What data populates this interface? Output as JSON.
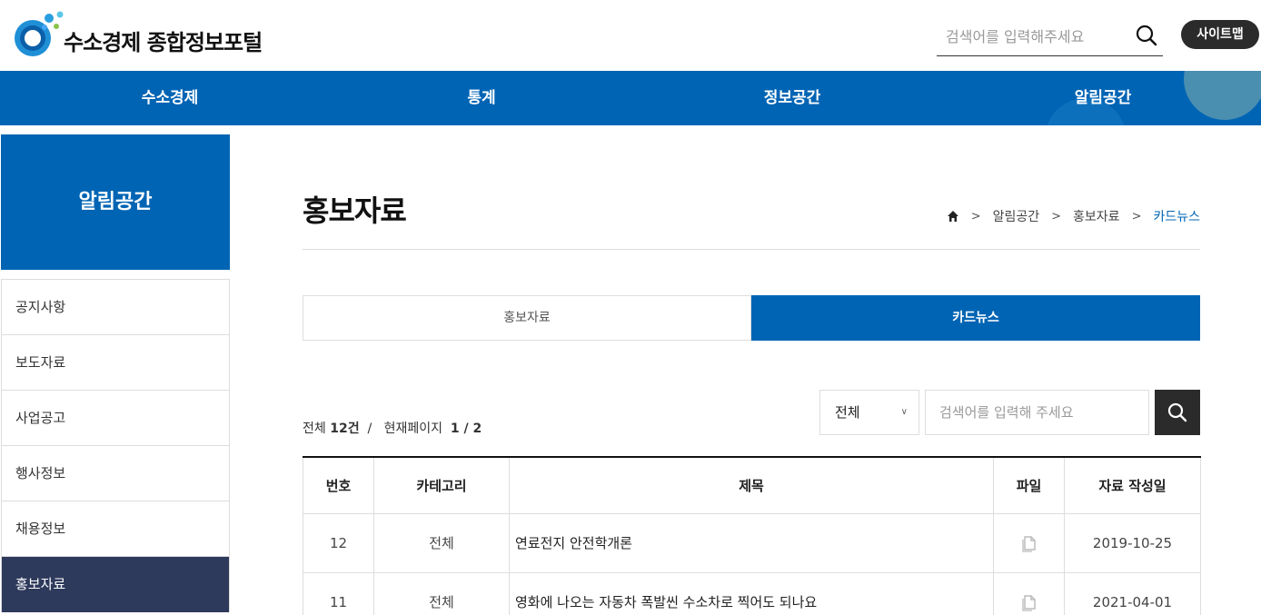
{
  "header": {
    "site_title": "수소경제 종합정보포털",
    "search_placeholder": "검색어를 입력해주세요",
    "sitemap_label": "사이트맵"
  },
  "gnb": {
    "items": [
      {
        "label": "수소경제"
      },
      {
        "label": "통계"
      },
      {
        "label": "정보공간"
      },
      {
        "label": "알림공간"
      }
    ]
  },
  "lnb": {
    "title": "알림공간",
    "items": [
      {
        "label": "공지사항",
        "active": false
      },
      {
        "label": "보도자료",
        "active": false
      },
      {
        "label": "사업공고",
        "active": false
      },
      {
        "label": "행사정보",
        "active": false
      },
      {
        "label": "채용정보",
        "active": false
      },
      {
        "label": "홍보자료",
        "active": true
      }
    ]
  },
  "page": {
    "title": "홍보자료",
    "breadcrumb": [
      "알림공간",
      "홍보자료",
      "카드뉴스"
    ]
  },
  "tabs": [
    {
      "label": "홍보자료",
      "active": false
    },
    {
      "label": "카드뉴스",
      "active": true
    }
  ],
  "list_info": {
    "total_label": "전체",
    "total_count": "12건",
    "separator": "/",
    "page_label": "현재페이지",
    "page_value": "1 / 2"
  },
  "filter": {
    "category_selected": "전체",
    "search_placeholder": "검색어를 입력해 주세요"
  },
  "table": {
    "columns": [
      "번호",
      "카테고리",
      "제목",
      "파일",
      "자료 작성일"
    ],
    "rows": [
      {
        "no": "12",
        "category": "전체",
        "title": "연료전지 안전학개론",
        "file_icon": "file-icon",
        "date": "2019-10-25"
      },
      {
        "no": "11",
        "category": "전체",
        "title": "영화에 나오는 자동차 폭발씬 수소차로 찍어도 되나요",
        "file_icon": "file-icon",
        "date": "2021-04-01"
      }
    ]
  },
  "colors": {
    "primary": "#0064b4",
    "lnb_active": "#2e3a5c",
    "dark_button": "#2b2b2b"
  }
}
